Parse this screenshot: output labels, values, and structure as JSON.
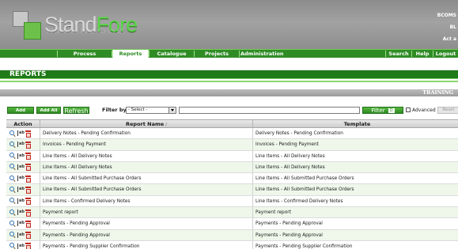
{
  "header": {
    "logo_stand": "Stand",
    "logo_fore": "Fore",
    "logo_reflect": "STANDFORE",
    "right_line1": "BCOMS",
    "right_line2": "BL",
    "right_line3": "Act a"
  },
  "nav": {
    "items": [
      {
        "label": "Process"
      },
      {
        "label": "Reports"
      },
      {
        "label": "Catalogue"
      },
      {
        "label": "Projects"
      },
      {
        "label": "Administration"
      },
      {
        "label": "Search"
      },
      {
        "label": "Help"
      },
      {
        "label": "Logout"
      }
    ],
    "active": "Reports"
  },
  "page": {
    "title": "REPORTS",
    "env_label": "TRAINING"
  },
  "toolbar": {
    "add_label": "Add",
    "add_all_label": "Add All",
    "refresh_label": "Refresh",
    "filter_by_label": "Filter by",
    "select_value": "- Select -",
    "filter_input_value": "",
    "filter_btn_label": "Filter",
    "filter_mini_label": "D",
    "advanced_label": "Advanced",
    "reset_label": "Reset"
  },
  "table": {
    "columns": [
      "Action",
      "Report Name",
      "Template"
    ],
    "sort_indicator": "/",
    "rows": [
      {
        "name": "Delivery Notes - Pending Confirmation",
        "template": "Delivery Notes - Pending Confirmation"
      },
      {
        "name": "Invoices - Pending Payment",
        "template": "Invoices - Pending Payment"
      },
      {
        "name": "Line Items - All Delivery Notes",
        "template": "Line Items - All Delivery Notes"
      },
      {
        "name": "Line Items - All Delivery Notes",
        "template": "Line Items - All Delivery Notes"
      },
      {
        "name": "Line Items - All Submitted Purchase Orders",
        "template": "Line Items - All Submitted Purchase Orders"
      },
      {
        "name": "Line Items - All Submitted Purchase Orders",
        "template": "Line Items - All Submitted Purchase Orders"
      },
      {
        "name": "Line Items - Confirmed Delivery Notes",
        "template": "Line Items - Confirmed Delivery Notes"
      },
      {
        "name": "Payment report",
        "template": "Payment report"
      },
      {
        "name": "Payments - Pending Approval",
        "template": "Payments - Pending Approval"
      },
      {
        "name": "Payments - Pending Approval",
        "template": "Payments - Pending Approval"
      },
      {
        "name": "Payments - Pending Supplier Confirmation",
        "template": "Payments - Pending Supplier Confirmation"
      }
    ],
    "action_icons": [
      "search-icon",
      "rename-icon",
      "delete-icon"
    ]
  },
  "colors": {
    "brand_green": "#2f8c25",
    "title_green": "#1f7a18",
    "row_tint": "#eef7ea",
    "header_gray": "#9a9a9a"
  }
}
